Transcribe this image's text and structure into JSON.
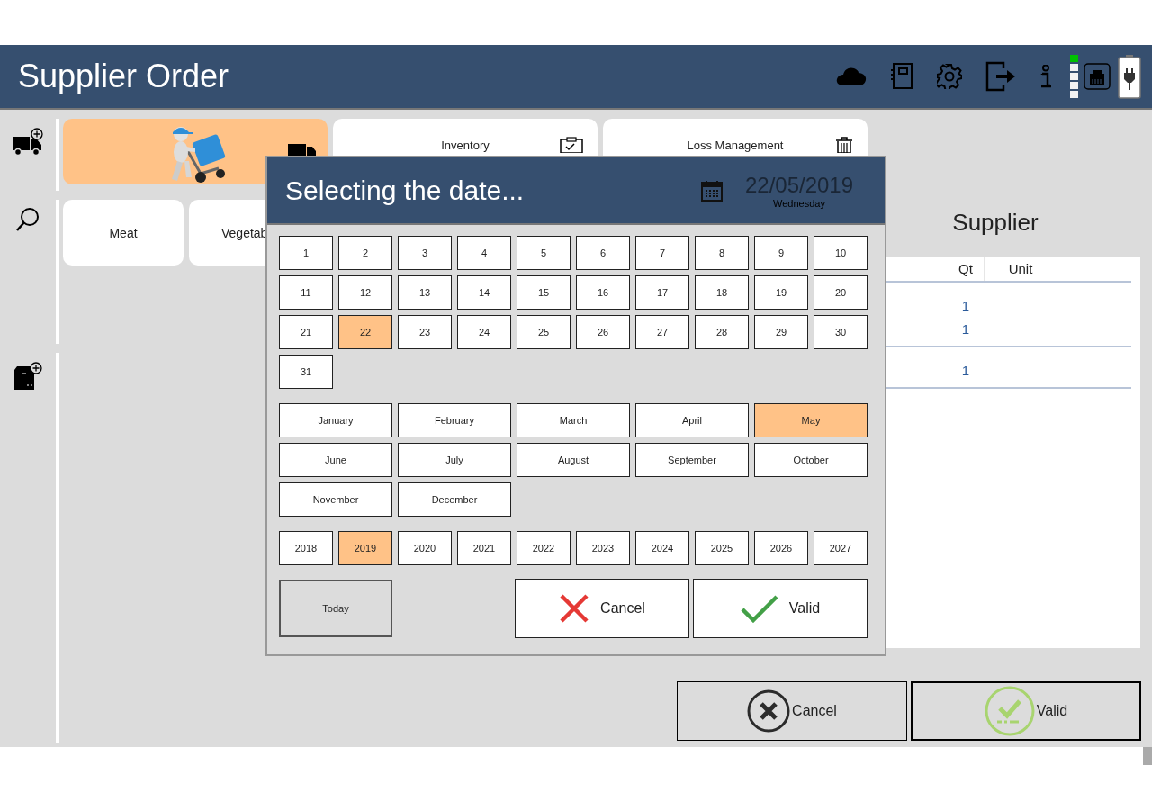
{
  "window": {
    "title": "Supplier Order"
  },
  "tiles": [
    {
      "kind": "picture",
      "selected": true
    },
    {
      "kind": "text",
      "label": "Inventory",
      "selected": false
    },
    {
      "kind": "text",
      "label": "Loss Management",
      "selected": false
    }
  ],
  "filters": [
    {
      "label": "Meat"
    },
    {
      "label": "Vegetab"
    }
  ],
  "order": {
    "title": "Supplier",
    "columns": [
      "Qt",
      "Unit"
    ],
    "groups": [
      {
        "rows": [
          {
            "qt": "1"
          },
          {
            "qt": "1"
          }
        ]
      },
      {
        "rows": [
          {
            "qt": "1"
          }
        ]
      }
    ]
  },
  "actions": [
    {
      "kind": "cancel",
      "label": "Cancel"
    },
    {
      "kind": "valid",
      "label": "Valid"
    }
  ],
  "date_dialog": {
    "title": "Selecting the date...",
    "date": "22/05/2019",
    "weekday": "Wednesday",
    "days": [
      {
        "label": "1",
        "selected": false
      },
      {
        "label": "2",
        "selected": false
      },
      {
        "label": "3",
        "selected": false
      },
      {
        "label": "4",
        "selected": false
      },
      {
        "label": "5",
        "selected": false
      },
      {
        "label": "6",
        "selected": false
      },
      {
        "label": "7",
        "selected": false
      },
      {
        "label": "8",
        "selected": false
      },
      {
        "label": "9",
        "selected": false
      },
      {
        "label": "10",
        "selected": false
      },
      {
        "label": "11",
        "selected": false
      },
      {
        "label": "12",
        "selected": false
      },
      {
        "label": "13",
        "selected": false
      },
      {
        "label": "14",
        "selected": false
      },
      {
        "label": "15",
        "selected": false
      },
      {
        "label": "16",
        "selected": false
      },
      {
        "label": "17",
        "selected": false
      },
      {
        "label": "18",
        "selected": false
      },
      {
        "label": "19",
        "selected": false
      },
      {
        "label": "20",
        "selected": false
      },
      {
        "label": "21",
        "selected": false
      },
      {
        "label": "22",
        "selected": true
      },
      {
        "label": "23",
        "selected": false
      },
      {
        "label": "24",
        "selected": false
      },
      {
        "label": "25",
        "selected": false
      },
      {
        "label": "26",
        "selected": false
      },
      {
        "label": "27",
        "selected": false
      },
      {
        "label": "28",
        "selected": false
      },
      {
        "label": "29",
        "selected": false
      },
      {
        "label": "30",
        "selected": false
      },
      {
        "label": "31",
        "selected": false
      }
    ],
    "months": [
      {
        "label": "January",
        "selected": false
      },
      {
        "label": "February",
        "selected": false
      },
      {
        "label": "March",
        "selected": false
      },
      {
        "label": "April",
        "selected": false
      },
      {
        "label": "May",
        "selected": true
      },
      {
        "label": "June",
        "selected": false
      },
      {
        "label": "July",
        "selected": false
      },
      {
        "label": "August",
        "selected": false
      },
      {
        "label": "September",
        "selected": false
      },
      {
        "label": "October",
        "selected": false
      },
      {
        "label": "November",
        "selected": false
      },
      {
        "label": "December",
        "selected": false
      }
    ],
    "years": [
      {
        "label": "2018",
        "selected": false
      },
      {
        "label": "2019",
        "selected": true
      },
      {
        "label": "2020",
        "selected": false
      },
      {
        "label": "2021",
        "selected": false
      },
      {
        "label": "2022",
        "selected": false
      },
      {
        "label": "2023",
        "selected": false
      },
      {
        "label": "2024",
        "selected": false
      },
      {
        "label": "2025",
        "selected": false
      },
      {
        "label": "2026",
        "selected": false
      },
      {
        "label": "2027",
        "selected": false
      }
    ],
    "today": "Today",
    "actions": [
      {
        "kind": "cancel",
        "label": "Cancel"
      },
      {
        "kind": "valid",
        "label": "Valid"
      }
    ]
  }
}
